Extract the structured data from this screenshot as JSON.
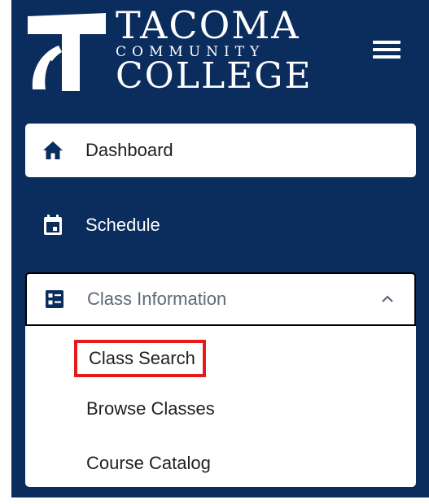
{
  "logo": {
    "line1": "TACOMA",
    "line2": "COMMUNITY",
    "line3": "COLLEGE"
  },
  "nav": {
    "items": [
      {
        "label": "Dashboard",
        "icon": "home-icon"
      },
      {
        "label": "Schedule",
        "icon": "calendar-icon"
      },
      {
        "label": "Class Information",
        "icon": "list-icon",
        "expanded": true
      }
    ],
    "submenu": [
      {
        "label": "Class Search",
        "highlighted": true
      },
      {
        "label": "Browse Classes"
      },
      {
        "label": "Course Catalog"
      }
    ]
  },
  "colors": {
    "sidebar_bg": "#0b2d5e",
    "highlight_border": "#e51b1b",
    "icon_navy": "#0b2d5e"
  }
}
